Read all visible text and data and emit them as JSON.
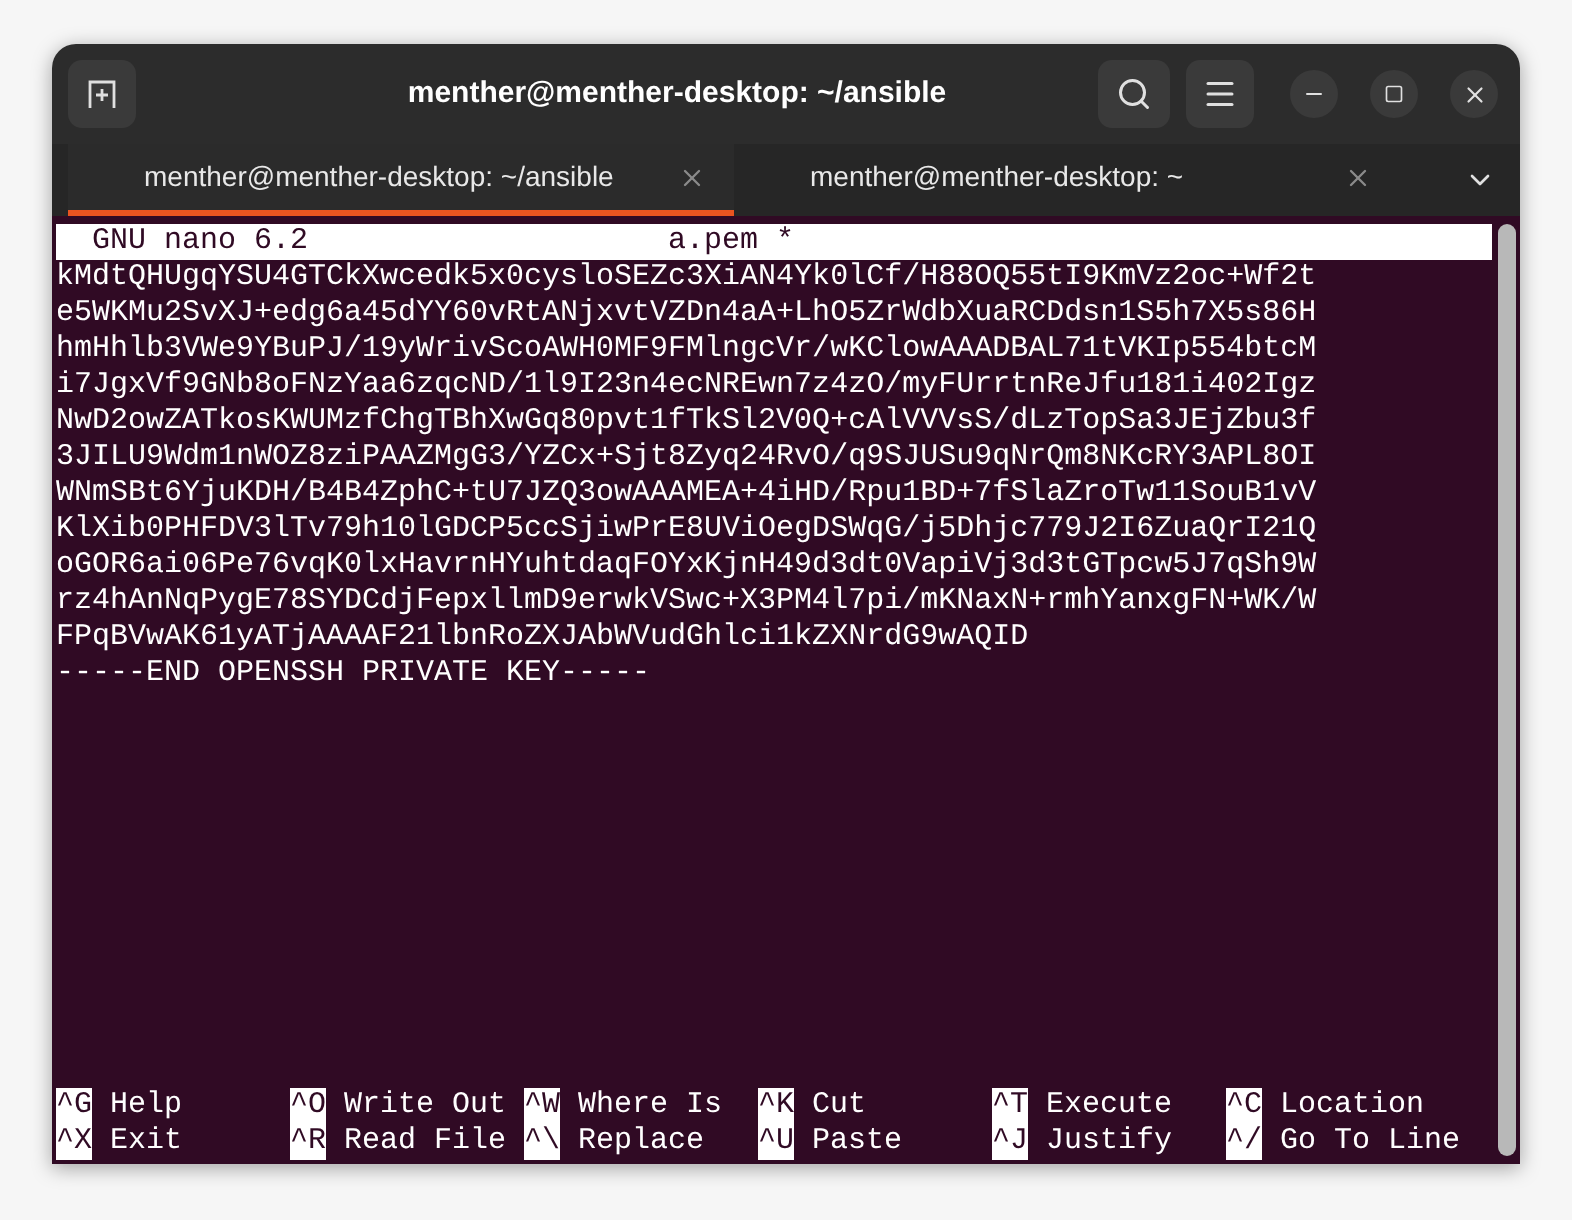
{
  "window": {
    "title": "menther@menther-desktop: ~/ansible"
  },
  "tabs": [
    {
      "label": "menther@menther-desktop: ~/ansible",
      "selected": true
    },
    {
      "label": "menther@menther-desktop: ~",
      "selected": false
    }
  ],
  "nano": {
    "version": "GNU nano 6.2",
    "filename": "a.pem *",
    "lines": [
      "kMdtQHUgqYSU4GTCkXwcedk5x0cysloSEZc3XiAN4Yk0lCf/H88OQ55tI9KmVz2oc+Wf2t",
      "e5WKMu2SvXJ+edg6a45dYY60vRtANjxvtVZDn4aA+LhO5ZrWdbXuaRCDdsn1S5h7X5s86H",
      "hmHhlb3VWe9YBuPJ/19yWrivScoAWH0MF9FMlngcVr/wKClowAAADBAL71tVKIp554btcM",
      "i7JgxVf9GNb8oFNzYaa6zqcND/1l9I23n4ecNREwn7z4zO/myFUrrtnReJfu181i402Igz",
      "NwD2owZATkosKWUMzfChgTBhXwGq80pvt1fTkSl2V0Q+cAlVVVsS/dLzTopSa3JEjZbu3f",
      "3JILU9Wdm1nWOZ8ziPAAZMgG3/YZCx+Sjt8Zyq24RvO/q9SJUSu9qNrQm8NKcRY3APL8OI",
      "WNmSBt6YjuKDH/B4B4ZphC+tU7JZQ3owAAAMEA+4iHD/Rpu1BD+7fSlaZroTw11SouB1vV",
      "KlXib0PHFDV3lTv79h10lGDCP5ccSjiwPrE8UViOegDSWqG/j5Dhjc779J2I6ZuaQrI21Q",
      "oGOR6ai06Pe76vqK0lxHavrnHYuhtdaqFOYxKjnH49d3dt0VapiVj3d3tGTpcw5J7qSh9W",
      "rz4hAnNqPygE78SYDCdjFepxllmD9erwkVSwc+X3PM4l7pi/mKNaxN+rmhYanxgFN+WK/W",
      "FPqBVwAK61yATjAAAAF21lbnRoZXJAbWVudGhlci1kZXNrdG9wAQID",
      "-----END OPENSSH PRIVATE KEY-----"
    ],
    "shortcuts": [
      [
        {
          "key": "^G",
          "label": "Help"
        },
        {
          "key": "^O",
          "label": "Write Out"
        },
        {
          "key": "^W",
          "label": "Where Is"
        },
        {
          "key": "^K",
          "label": "Cut"
        },
        {
          "key": "^T",
          "label": "Execute"
        },
        {
          "key": "^C",
          "label": "Location"
        }
      ],
      [
        {
          "key": "^X",
          "label": "Exit"
        },
        {
          "key": "^R",
          "label": "Read File"
        },
        {
          "key": "^\\",
          "label": "Replace"
        },
        {
          "key": "^U",
          "label": "Paste"
        },
        {
          "key": "^J",
          "label": "Justify"
        },
        {
          "key": "^/",
          "label": "Go To Line"
        }
      ]
    ]
  }
}
